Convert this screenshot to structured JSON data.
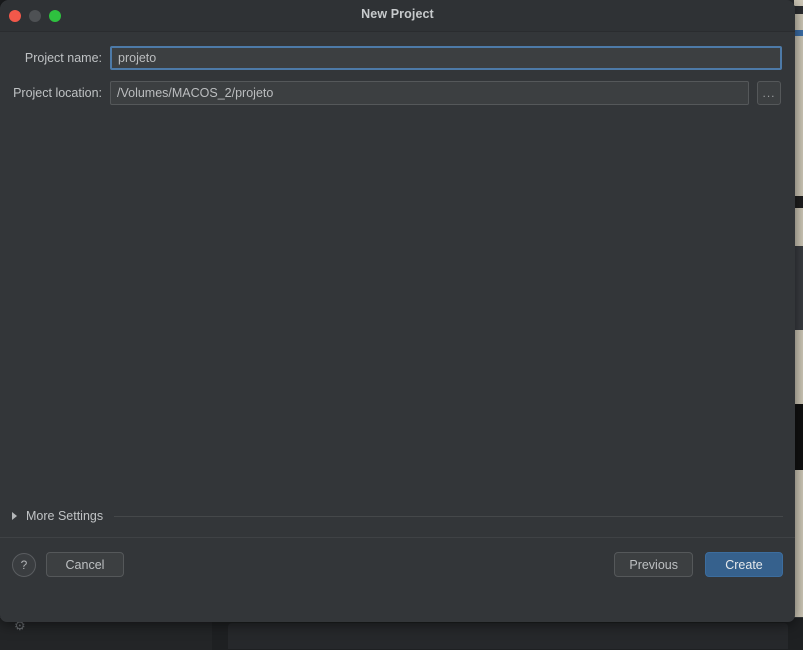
{
  "window": {
    "title": "New Project",
    "controls": {
      "close": "close-button",
      "minimize": "minimize-button",
      "zoom": "zoom-button"
    }
  },
  "form": {
    "project_name": {
      "label": "Project name:",
      "value": "projeto",
      "placeholder": ""
    },
    "project_location": {
      "label": "Project location:",
      "value": "/Volumes/MACOS_2/projeto",
      "placeholder": "",
      "browse_label": "..."
    }
  },
  "more_settings": {
    "label": "More Settings",
    "expanded": false
  },
  "footer": {
    "help_label": "?",
    "cancel_label": "Cancel",
    "previous_label": "Previous",
    "create_label": "Create"
  },
  "background": {
    "gear_icon": "⚙"
  },
  "colors": {
    "dialog_bg": "#333639",
    "titlebar_bg": "#2f3235",
    "input_bg": "#3c3f41",
    "focus_border": "#4d7aa8",
    "primary_button": "#36618d",
    "traffic_close": "#f2584a",
    "traffic_minimize": "#4e5154",
    "traffic_zoom": "#2ec13f",
    "text": "#bfc2c4"
  }
}
